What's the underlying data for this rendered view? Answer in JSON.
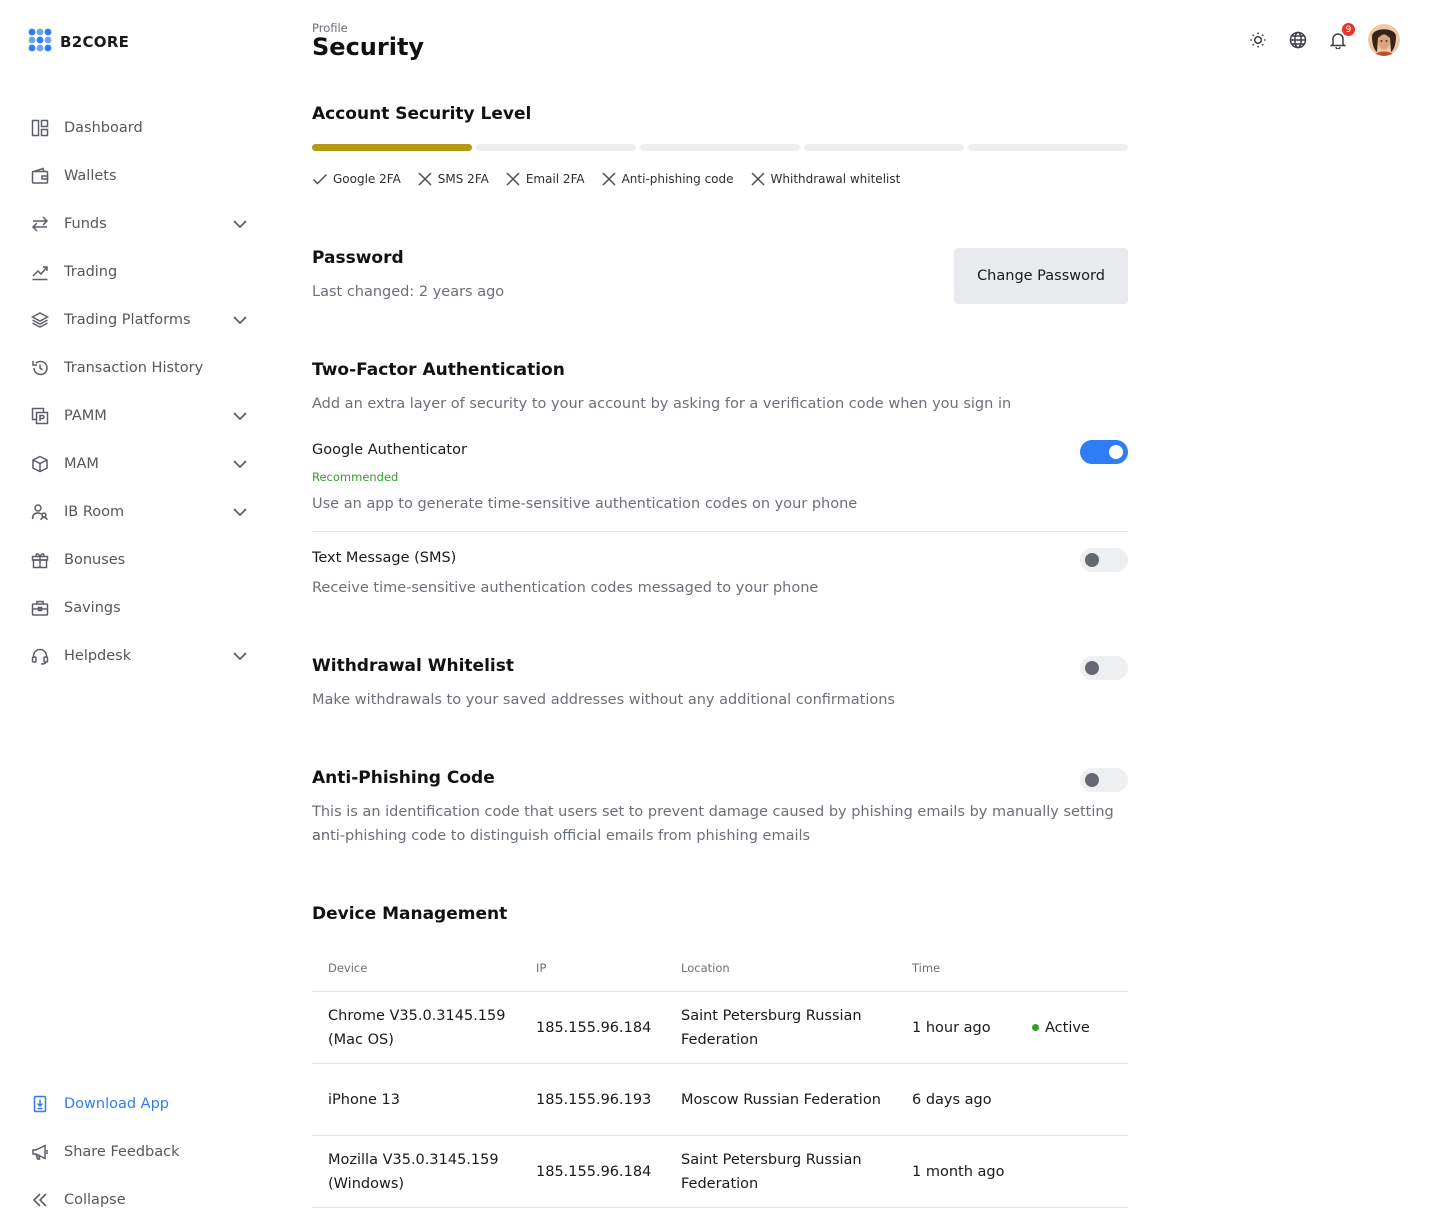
{
  "brand": {
    "name": "B2CORE"
  },
  "sidebar": {
    "items": [
      {
        "label": "Dashboard",
        "icon": "dashboard-icon",
        "has_chevron": false
      },
      {
        "label": "Wallets",
        "icon": "wallet-icon",
        "has_chevron": false
      },
      {
        "label": "Funds",
        "icon": "transfer-icon",
        "has_chevron": true
      },
      {
        "label": "Trading",
        "icon": "chart-line-icon",
        "has_chevron": false
      },
      {
        "label": "Trading Platforms",
        "icon": "layers-icon",
        "has_chevron": true
      },
      {
        "label": "Transaction History",
        "icon": "history-icon",
        "has_chevron": false
      },
      {
        "label": "PAMM",
        "icon": "pamm-icon",
        "has_chevron": true
      },
      {
        "label": "MAM",
        "icon": "cube-icon",
        "has_chevron": true
      },
      {
        "label": "IB Room",
        "icon": "users-icon",
        "has_chevron": true
      },
      {
        "label": "Bonuses",
        "icon": "gift-icon",
        "has_chevron": false
      },
      {
        "label": "Savings",
        "icon": "briefcase-icon",
        "has_chevron": false
      },
      {
        "label": "Helpdesk",
        "icon": "headset-icon",
        "has_chevron": true
      }
    ],
    "bottom": {
      "download": "Download App",
      "feedback": "Share Feedback",
      "collapse": "Collapse"
    }
  },
  "header": {
    "breadcrumb": "Profile",
    "title": "Security",
    "notification_count": "9"
  },
  "security_level": {
    "title": "Account Security Level",
    "segments_total": 5,
    "segments_filled": 1,
    "fill_color": "#b49a12",
    "checks": [
      {
        "label": "Google 2FA",
        "status": "done"
      },
      {
        "label": "SMS 2FA",
        "status": "missing"
      },
      {
        "label": "Email 2FA",
        "status": "missing"
      },
      {
        "label": "Anti-phishing code",
        "status": "missing"
      },
      {
        "label": "Whithdrawal whitelist",
        "status": "missing"
      }
    ]
  },
  "password": {
    "title": "Password",
    "last_changed": "Last changed: 2 years ago",
    "button": "Change Password"
  },
  "two_factor": {
    "title": "Two-Factor Authentication",
    "description": "Add an extra layer of security to your account by asking for a verification code when you sign in",
    "google": {
      "title": "Google Authenticator",
      "badge": "Recommended",
      "description": "Use an app to generate time-sensitive authentication codes on your phone",
      "enabled": true
    },
    "sms": {
      "title": "Text Message (SMS)",
      "description": "Receive time-sensitive authentication codes messaged to your phone",
      "enabled": false
    }
  },
  "withdrawal": {
    "title": "Withdrawal Whitelist",
    "description": "Make withdrawals to your saved addresses without any additional confirmations",
    "enabled": false
  },
  "anti_phishing": {
    "title": "Anti-Phishing Code",
    "description_line1": "This is an identification code that users set to prevent damage caused by phishing emails by manually setting an",
    "description_line2": "anti-phishing code to distinguish official emails from phishing emails",
    "enabled": false
  },
  "devices": {
    "title": "Device Management",
    "columns": {
      "device": "Device",
      "ip": "IP",
      "location": "Location",
      "time": "Time"
    },
    "rows": [
      {
        "device_l1": "Chrome V35.0.3145.159",
        "device_l2": "(Mac OS)",
        "ip": "185.155.96.184",
        "location_l1": "Saint Petersburg Russian",
        "location_l2": "Federation",
        "time": "1 hour ago",
        "status": "Active"
      },
      {
        "device_l1": "iPhone 13",
        "device_l2": "",
        "ip": "185.155.96.193",
        "location_l1": "Moscow Russian Federation",
        "location_l2": "",
        "time": "6 days ago",
        "status": ""
      },
      {
        "device_l1": "Mozilla V35.0.3145.159",
        "device_l2": "(Windows)",
        "ip": "185.155.96.184",
        "location_l1": "Saint Petersburg Russian",
        "location_l2": "Federation",
        "time": "1 month ago",
        "status": ""
      }
    ]
  },
  "colors": {
    "accent": "#2e7cf6",
    "success": "#3a9a2c",
    "badge": "#e5342a"
  }
}
